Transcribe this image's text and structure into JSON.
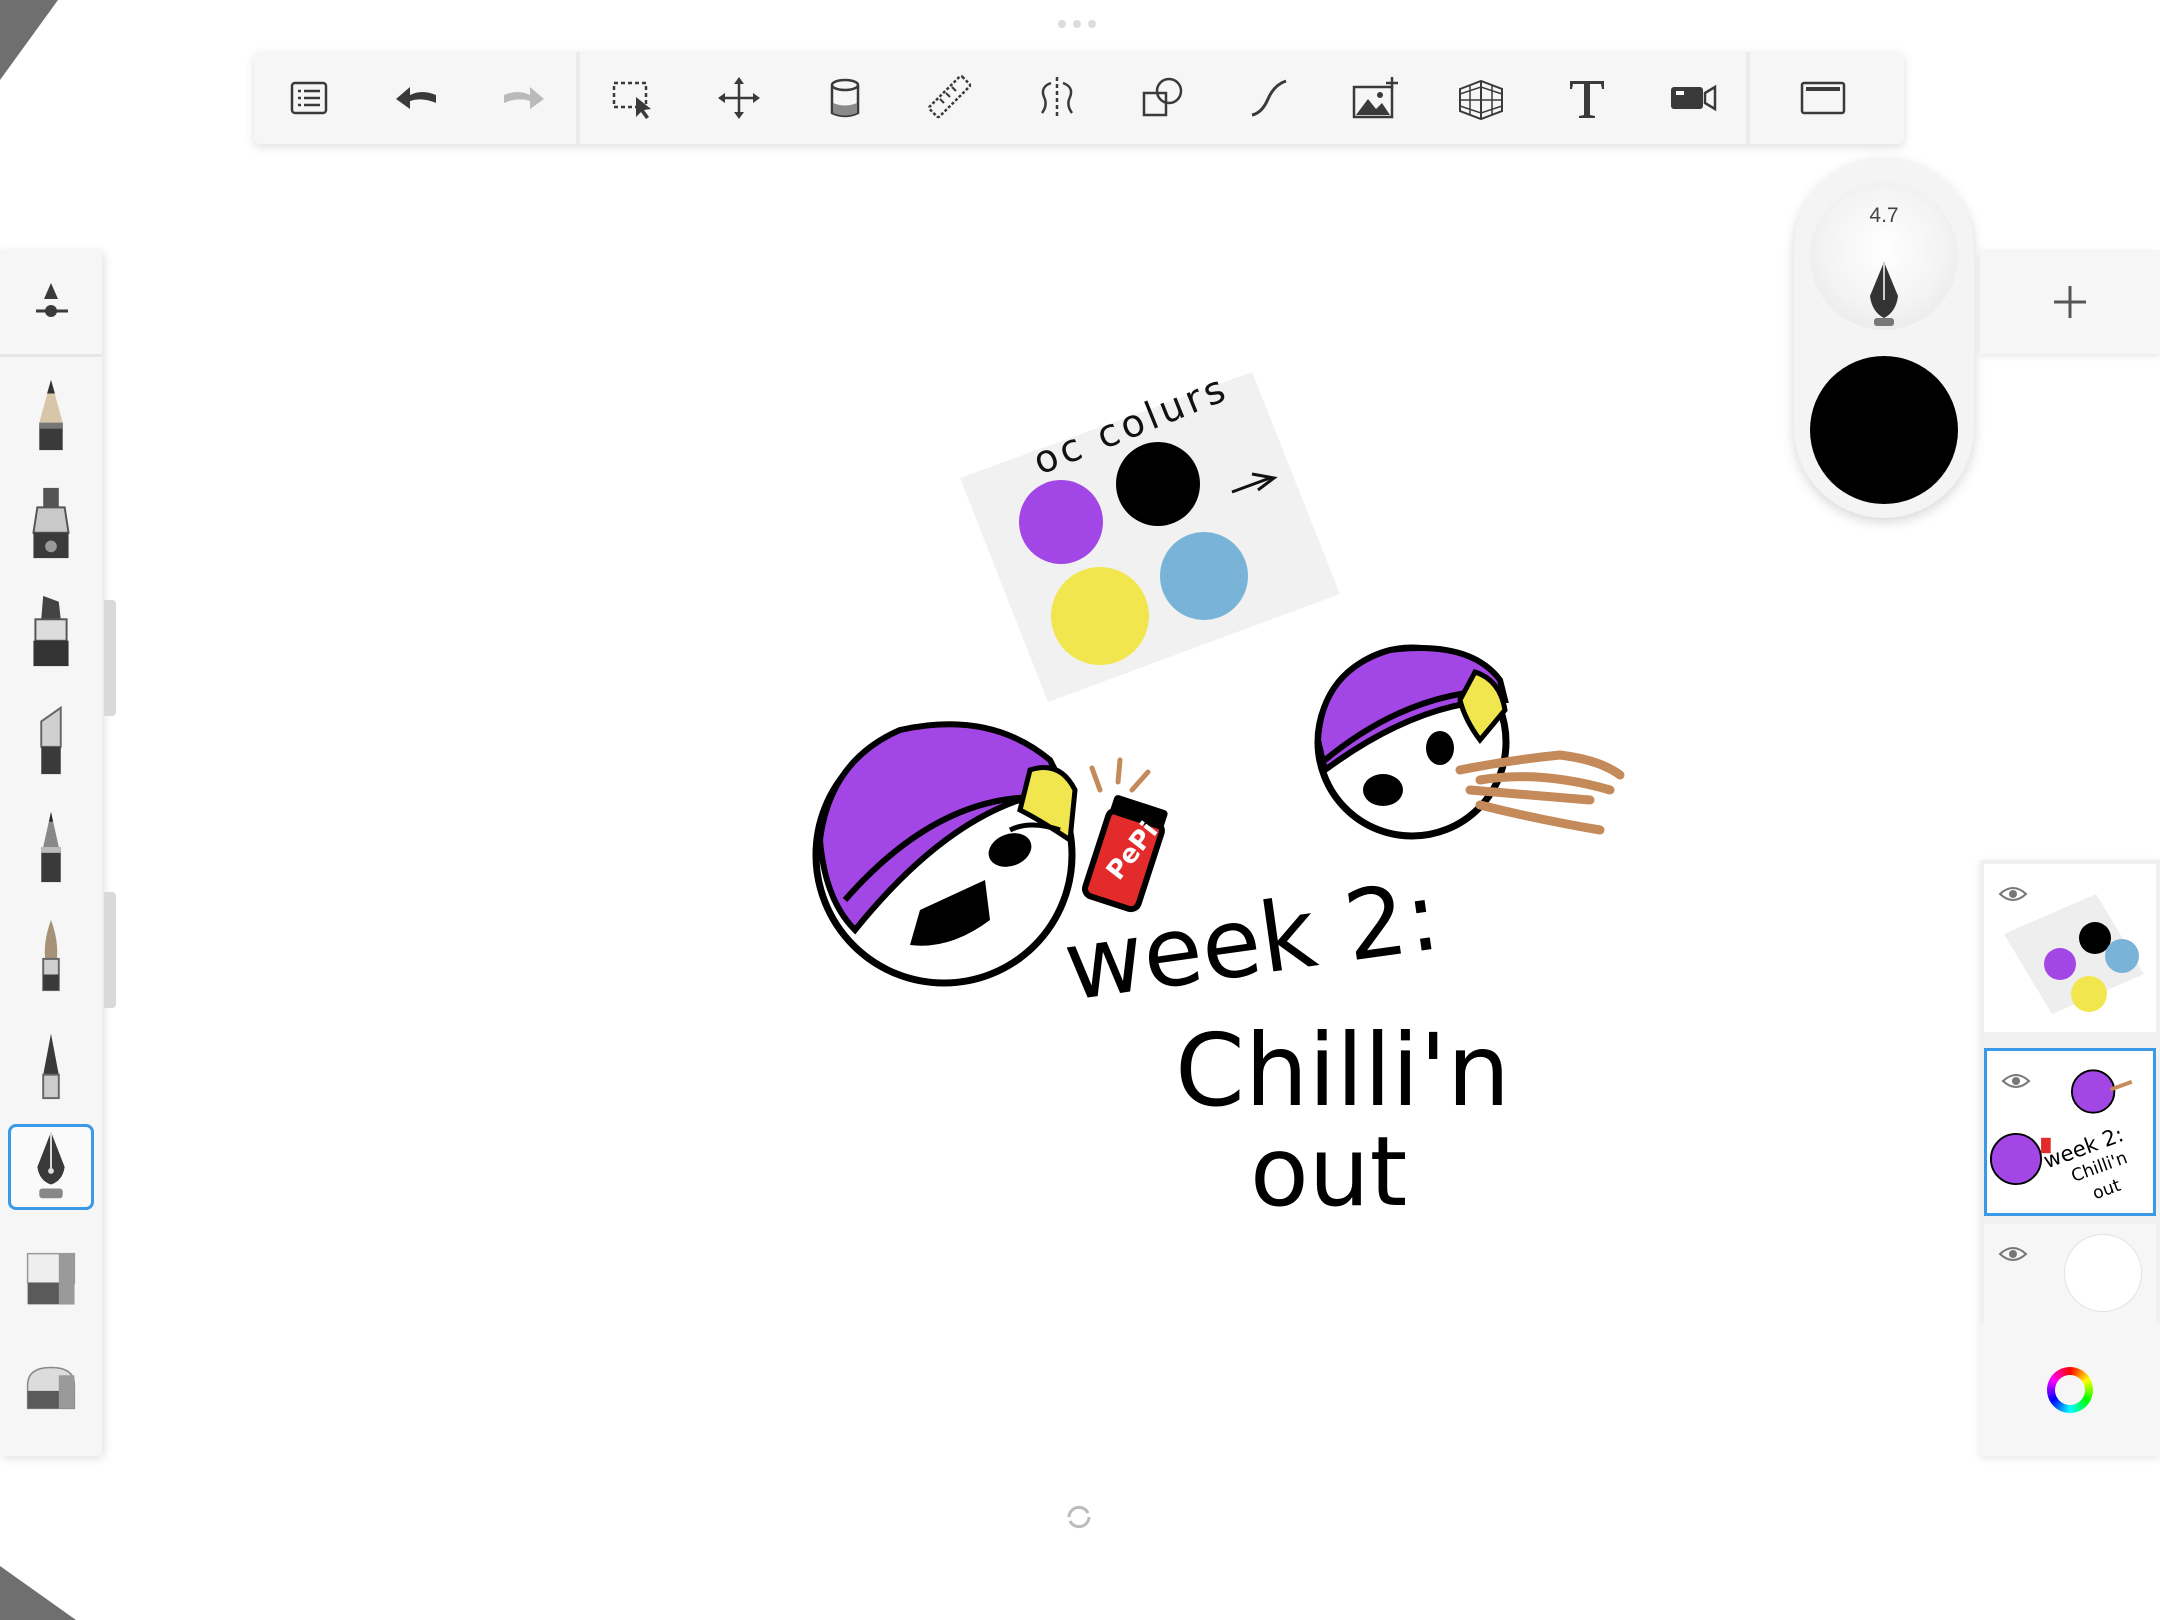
{
  "app": "Sketchbook",
  "toolbar": {
    "tools": [
      {
        "name": "list-icon"
      },
      {
        "name": "undo-icon"
      },
      {
        "name": "redo-icon"
      },
      {
        "name": "selection-icon"
      },
      {
        "name": "transform-icon"
      },
      {
        "name": "fill-icon"
      },
      {
        "name": "ruler-icon"
      },
      {
        "name": "symmetry-icon"
      },
      {
        "name": "shapes-icon"
      },
      {
        "name": "curve-icon"
      },
      {
        "name": "add-image-icon"
      },
      {
        "name": "perspective-icon"
      },
      {
        "name": "text-icon"
      },
      {
        "name": "record-icon"
      },
      {
        "name": "fullscreen-icon"
      }
    ]
  },
  "brushes": [
    "brush-properties",
    "pencil",
    "inking-pen",
    "marker",
    "chisel-marker",
    "technical-pen",
    "paintbrush",
    "ballpoint-pen",
    "calligraphy-pen",
    "soft-eraser",
    "hard-eraser"
  ],
  "selected_brush": "calligraphy-pen",
  "puck": {
    "brush_size": "4.7",
    "color": "#000000"
  },
  "layers": [
    {
      "name": "palette-layer",
      "visible": true
    },
    {
      "name": "drawing-layer",
      "visible": true,
      "selected": true
    },
    {
      "name": "background-layer",
      "visible": true
    }
  ],
  "artwork": {
    "palette_label": "oc colurs",
    "title_lines": [
      "week 2:",
      "Chilli'n",
      "out"
    ],
    "can_label": "PePi",
    "palette_colors": [
      "#a346e6",
      "#000000",
      "#f2e64e",
      "#7ab3d8"
    ],
    "brown": "#c48a5a"
  },
  "colors": {
    "accent": "#3a9ae8",
    "panel": "#f6f6f6",
    "icon": "#3a3a3a"
  }
}
